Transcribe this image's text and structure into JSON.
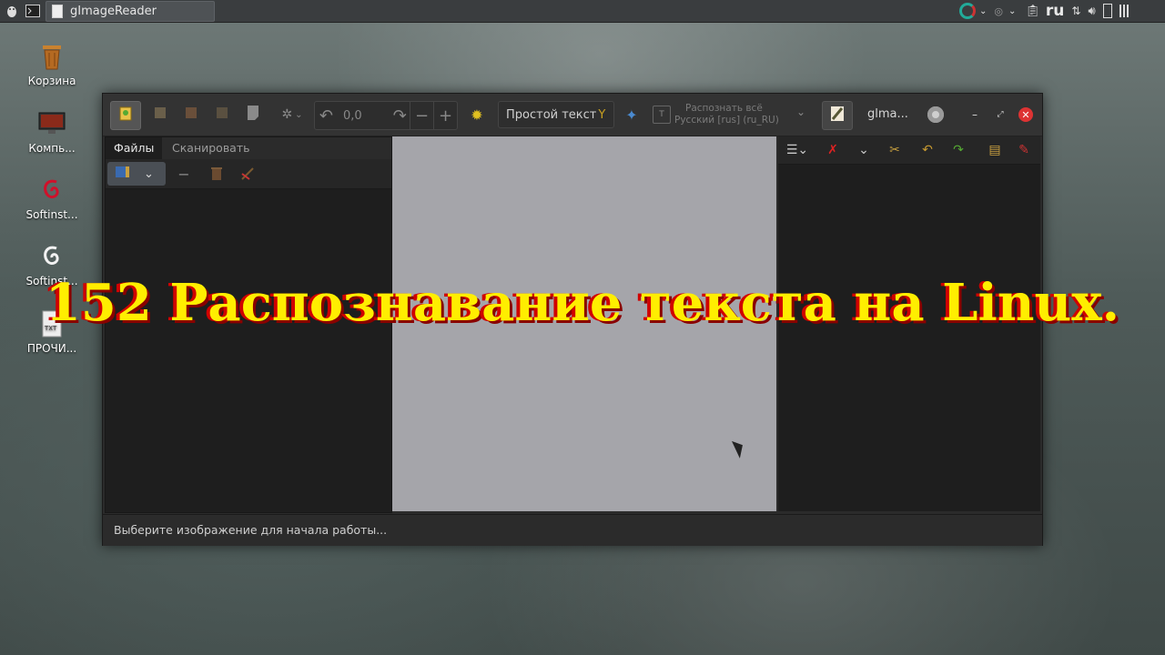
{
  "panel": {
    "taskbar_window_title": "gImageReader",
    "keyboard_layout": "ru"
  },
  "desktop": {
    "icons": [
      {
        "label": "Корзина"
      },
      {
        "label": "Компь..."
      },
      {
        "label": "Softinst..."
      },
      {
        "label": "Softinst..."
      },
      {
        "label": "ПРОЧИ..."
      }
    ]
  },
  "window": {
    "title": "glma...",
    "toolbar": {
      "rotation_value": "0,0",
      "output_mode": "Простой текст",
      "recognize_line1": "Распознать всё",
      "recognize_line2": "Русский [rus] (ru_RU)"
    },
    "left_pane": {
      "tabs": [
        "Файлы",
        "Сканировать"
      ]
    },
    "status_text": "Выберите изображение для начала работы..."
  },
  "overlay_title": "152 Распознавание текста на Linux.",
  "colors": {
    "overlay_text": "#ffee00",
    "overlay_shadow": "#d00000",
    "close_button": "#dd3333"
  }
}
